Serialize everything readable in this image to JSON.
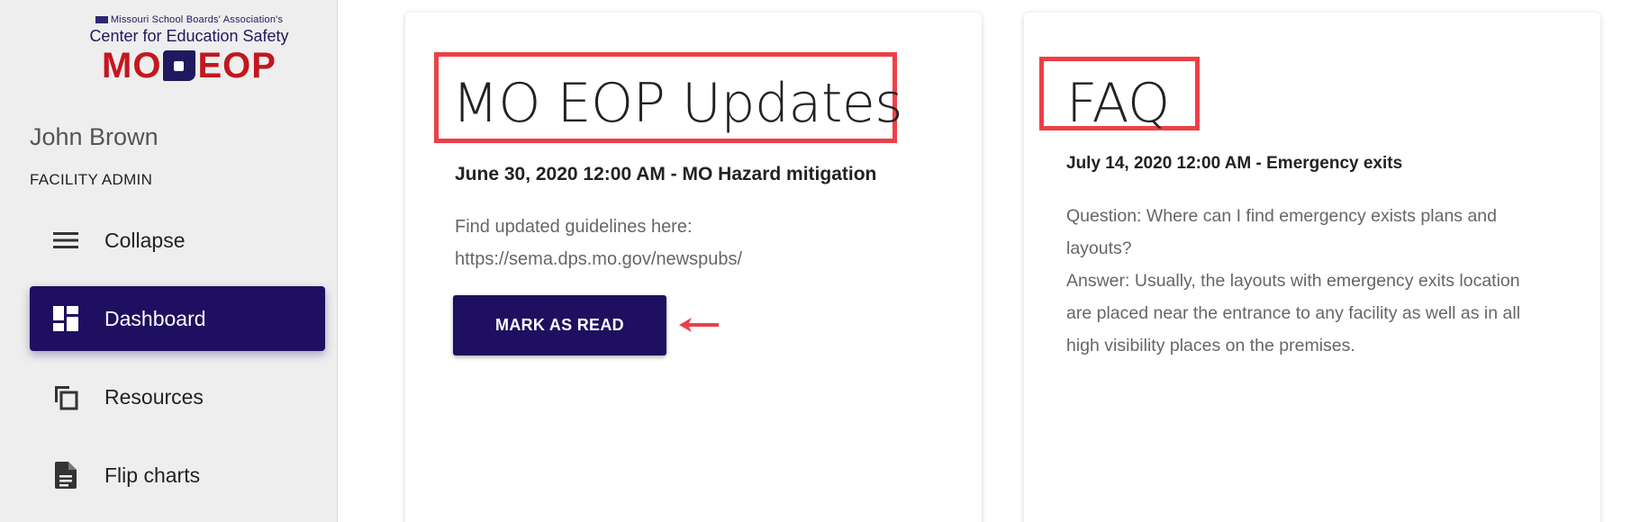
{
  "logo": {
    "line1": "Missouri School Boards' Association's",
    "line2": "Center for Education Safety",
    "line3_left": "MO",
    "line3_right": "EOP"
  },
  "user": {
    "name": "John Brown",
    "role": "FACILITY ADMIN"
  },
  "nav": {
    "items": [
      {
        "label": "Collapse",
        "icon": "menu-icon",
        "active": false
      },
      {
        "label": "Dashboard",
        "icon": "dashboard-icon",
        "active": true
      },
      {
        "label": "Resources",
        "icon": "copy-icon",
        "active": false
      },
      {
        "label": "Flip charts",
        "icon": "document-icon",
        "active": false
      }
    ]
  },
  "cards": [
    {
      "title": "MO EOP Updates",
      "item_heading": "June 30, 2020 12:00 AM - MO Hazard mitigation",
      "body_line1": "Find updated guidelines here:",
      "body_line2": "https://sema.dps.mo.gov/newspubs/",
      "button_label": "MARK AS READ"
    },
    {
      "title": "FAQ",
      "item_heading": "July 14, 2020 12:00 AM - Emergency exits",
      "body_line1": "Question: Where can I find emergency exists plans and",
      "body_line2": "layouts?",
      "body_line3": "Answer: Usually, the layouts with emergency exits location",
      "body_line4": "are placed near the entrance to any facility as well as in all",
      "body_line5": "high visibility places on the premises."
    }
  ],
  "colors": {
    "primary": "#1f0f60",
    "annotation": "#ec4047",
    "logo_red": "#c3171f",
    "sidebar_bg": "#eeeeee"
  }
}
